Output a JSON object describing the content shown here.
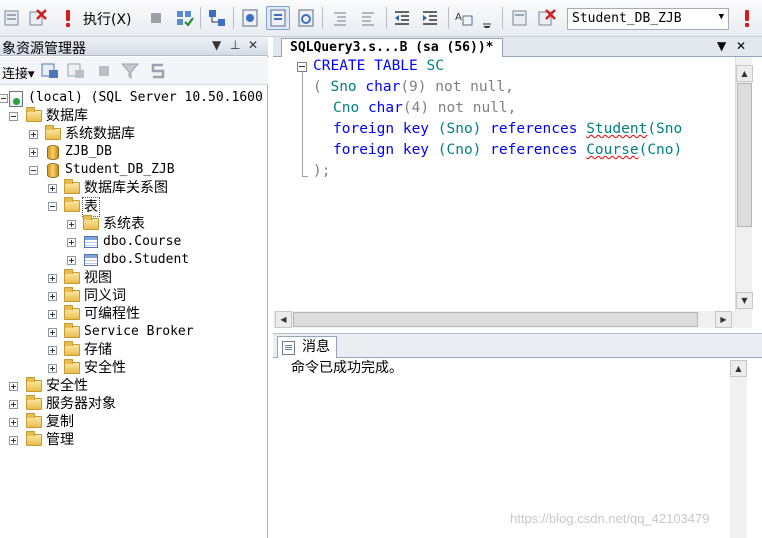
{
  "toolbar": {
    "execute_label": "执行(X)",
    "database_select": "Student_DB_ZJB"
  },
  "object_explorer": {
    "title": "象资源管理器",
    "connect_label": "连接▾"
  },
  "tree": {
    "server": "(local) (SQL Server 10.50.1600",
    "databases": "数据库",
    "system_databases": "系统数据库",
    "db_zjb": "ZJB_DB",
    "db_student": "Student_DB_ZJB",
    "db_diagrams": "数据库关系图",
    "tables": "表",
    "system_tables": "系统表",
    "table_course": "dbo.Course",
    "table_student": "dbo.Student",
    "views": "视图",
    "synonyms": "同义词",
    "programmability": "可编程性",
    "service_broker": "Service Broker",
    "storage": "存储",
    "db_security": "安全性",
    "security": "安全性",
    "server_objects": "服务器对象",
    "replication": "复制",
    "management": "管理"
  },
  "editor": {
    "tab_title": "SQLQuery3.s...B (sa (56))*",
    "code": {
      "l1_kw": "CREATE TABLE",
      "l1_id": "SC",
      "l2_a": "( ",
      "l2_col": "Sno",
      "l2_type": "char",
      "l2_size": "(9)",
      "l2_rest": " not null,",
      "l3_col": "Cno",
      "l3_type": "char",
      "l3_size": "(4)",
      "l3_rest": " not null,",
      "l4_kw": "foreign key",
      "l4_col": "(Sno)",
      "l4_ref": "references",
      "l4_tbl": "Student",
      "l4_tail": "(Sno",
      "l5_kw": "foreign key",
      "l5_col": "(Cno)",
      "l5_ref": "references",
      "l5_tbl": "Course",
      "l5_tail": "(Cno)",
      "l6": ");"
    }
  },
  "results": {
    "tab_label": "消息",
    "message": "命令已成功完成。"
  },
  "watermark": "https://blog.csdn.net/qq_42103479",
  "colors": {
    "keyword": "#0000ff",
    "identifier": "#008080",
    "punctuation": "#808080"
  }
}
